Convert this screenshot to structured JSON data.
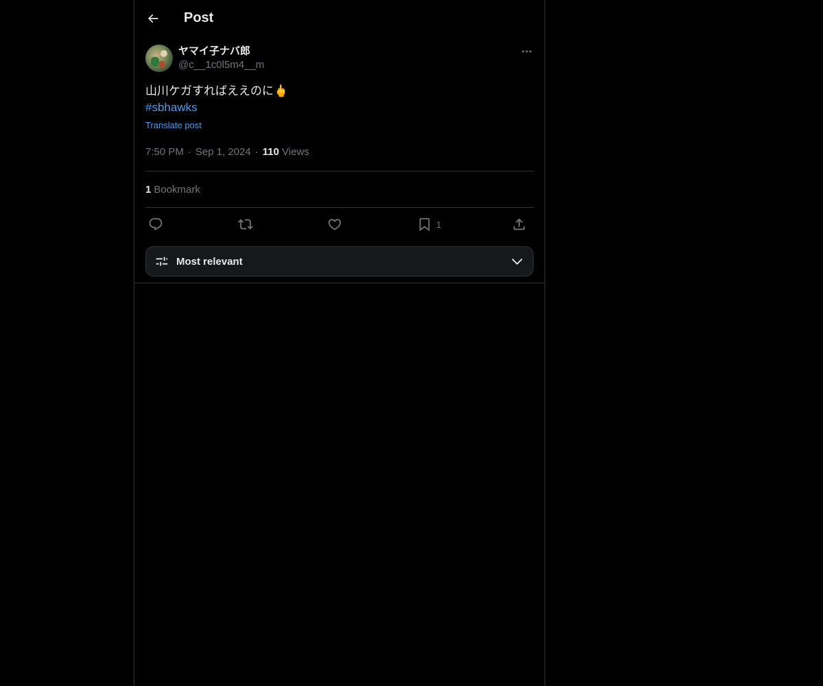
{
  "header": {
    "title": "Post",
    "back_icon": "arrow-left-icon"
  },
  "post": {
    "author": {
      "display_name": "ヤマイ子ナバ郎",
      "handle": "@c__1c0l5m4__m"
    },
    "text": "山川ケガすればええのに🖕",
    "hashtag": "#sbhawks",
    "translate_label": "Translate post",
    "time": "7:50 PM",
    "date": "Sep 1, 2024",
    "views_count": "110",
    "views_label": "Views",
    "bookmarks_count": "1",
    "bookmarks_label": "Bookmark"
  },
  "actions": {
    "reply": {
      "icon": "reply-icon",
      "count": ""
    },
    "repost": {
      "icon": "repost-icon",
      "count": ""
    },
    "like": {
      "icon": "heart-icon",
      "count": ""
    },
    "bookmark": {
      "icon": "bookmark-icon",
      "count": "1"
    },
    "share": {
      "icon": "share-icon",
      "count": ""
    }
  },
  "sort": {
    "label": "Most relevant",
    "icon": "sliders-icon",
    "chevron": "chevron-down-icon"
  },
  "colors": {
    "background": "#000000",
    "text": "#e7e9ea",
    "muted": "#71767b",
    "link": "#4c9be8",
    "border": "#2f3336"
  }
}
